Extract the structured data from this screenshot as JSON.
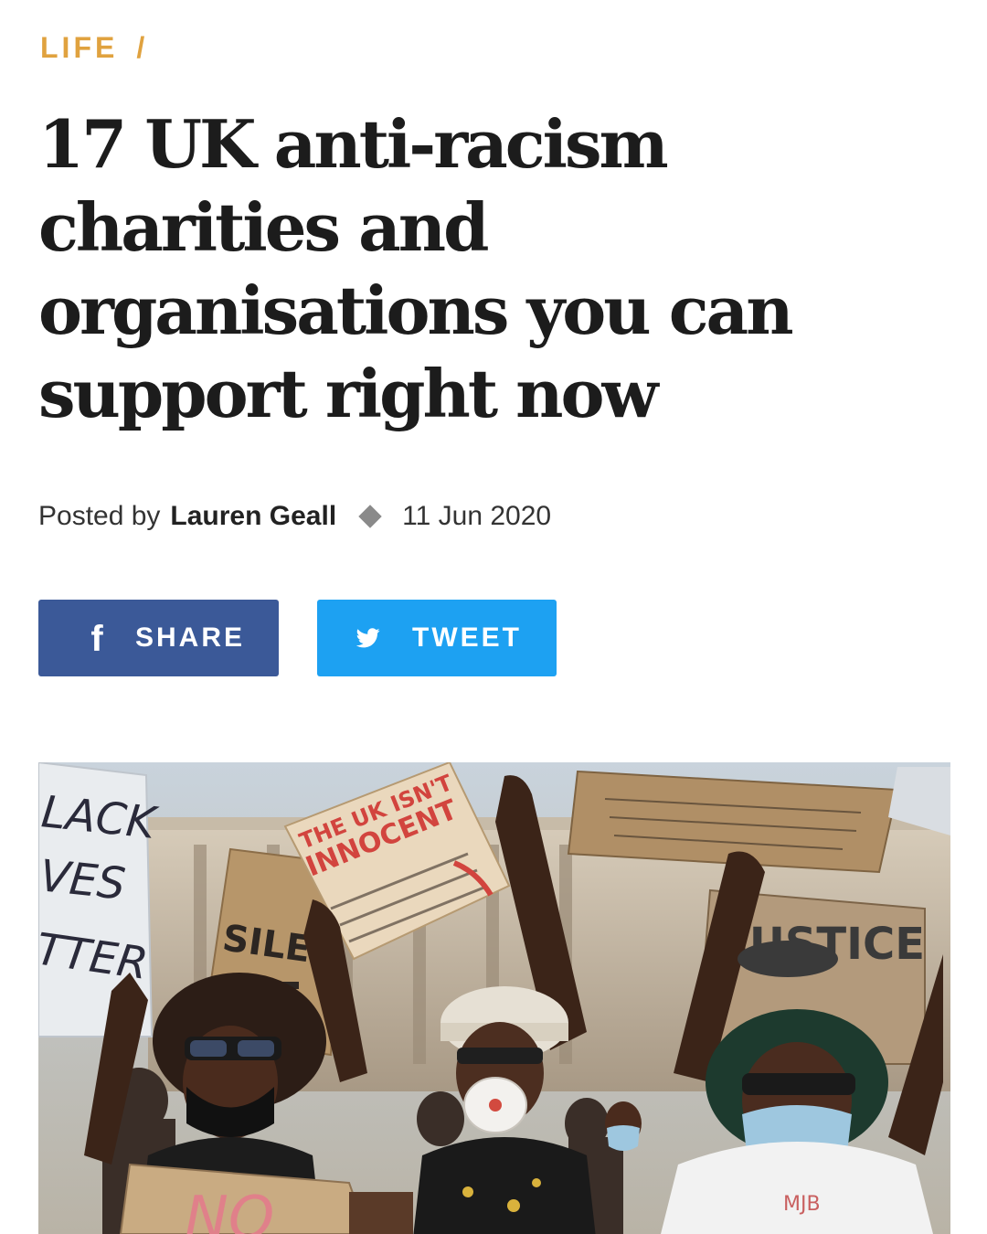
{
  "breadcrumb": {
    "section": "LIFE",
    "separator": "/"
  },
  "article": {
    "title": "17 UK anti-racism charities and organisations you can support right now",
    "byline_prefix": "Posted by",
    "author": "Lauren Geall",
    "date": "11 Jun 2020"
  },
  "share": {
    "facebook_label": "SHARE",
    "twitter_label": "TWEET",
    "facebook_icon": "facebook-icon",
    "twitter_icon": "twitter-bird-icon"
  },
  "hero_image": {
    "description_icon": "protest-photo",
    "signs": {
      "left_sign": [
        "LACK",
        "VES",
        "TTER"
      ],
      "silence_sign": "SILEN",
      "uk_sign_line1": "THE UK ISN'T",
      "uk_sign_line2": "INNOCENT",
      "justice_sign": "JUSTICE",
      "bottom_sign": "NO"
    }
  },
  "colors": {
    "accent": "#e0a23f",
    "facebook": "#3b5998",
    "twitter": "#1da1f2",
    "text": "#1c1c1c"
  }
}
